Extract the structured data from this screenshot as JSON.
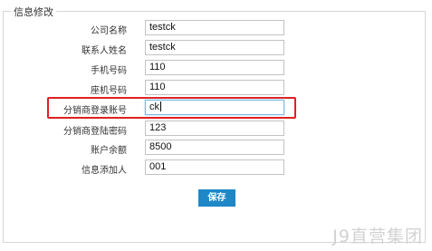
{
  "form": {
    "legend": "信息修改",
    "fields": [
      {
        "label": "公司名称",
        "value": "testck"
      },
      {
        "label": "联系人姓名",
        "value": "testck"
      },
      {
        "label": "手机号码",
        "value": "110"
      },
      {
        "label": "座机号码",
        "value": "110"
      },
      {
        "label": "分销商登录账号",
        "value": "ck"
      },
      {
        "label": "分销商登陆密码",
        "value": "123"
      },
      {
        "label": "账户余额",
        "value": "8500"
      },
      {
        "label": "信息添加人",
        "value": "001"
      }
    ],
    "save_label": "保存"
  },
  "watermark": "J9直营集团",
  "colors": {
    "highlight": "#e02020",
    "button": "#1e88c7",
    "focus_border": "#7cb7e8"
  }
}
